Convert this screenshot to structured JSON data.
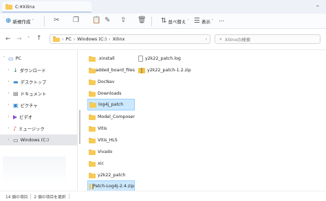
{
  "window": {
    "title": "C:¥Xilinx",
    "minimize_glyph": "–"
  },
  "toolbar": {
    "new_label": "新規作成",
    "sort_label": "並べ替え",
    "view_label": "表示",
    "more_label": "…",
    "icons": [
      "cut-icon",
      "copy-icon",
      "paste-icon",
      "rename-icon",
      "share-icon",
      "delete-icon"
    ]
  },
  "address": {
    "path": [
      "PC",
      "Windows (C:)",
      "Xilinx"
    ],
    "search_placeholder": "Xilinxの検索"
  },
  "sidebar": {
    "items": [
      {
        "label": "PC",
        "icon": "pc-icon",
        "expanded": true
      },
      {
        "label": "ダウンロード",
        "icon": "download-icon"
      },
      {
        "label": "デスクトップ",
        "icon": "desktop-icon"
      },
      {
        "label": "ドキュメント",
        "icon": "documents-icon"
      },
      {
        "label": "ピクチャ",
        "icon": "pictures-icon"
      },
      {
        "label": "ビデオ",
        "icon": "videos-icon"
      },
      {
        "label": "ミュージック",
        "icon": "music-icon"
      },
      {
        "label": "Windows (C:)",
        "icon": "drive-icon",
        "selected": true
      }
    ]
  },
  "files": {
    "column1": [
      {
        "name": ".xinstall",
        "type": "folder"
      },
      {
        "name": "added_board_files",
        "type": "folder"
      },
      {
        "name": "DocNav",
        "type": "folder"
      },
      {
        "name": "Downloads",
        "type": "folder"
      },
      {
        "name": "log4j_patch",
        "type": "folder",
        "selected": true
      },
      {
        "name": "Model_Composer",
        "type": "folder"
      },
      {
        "name": "Vitis",
        "type": "folder"
      },
      {
        "name": "Vitis_HLS",
        "type": "folder"
      },
      {
        "name": "Vivado",
        "type": "folder"
      },
      {
        "name": "xic",
        "type": "folder"
      },
      {
        "name": "y2k22_patch",
        "type": "folder"
      },
      {
        "name": "Patch-Log4j-2.4.zip",
        "type": "zip",
        "selected": true
      }
    ],
    "column2": [
      {
        "name": "y2k22_patch.log",
        "type": "file"
      },
      {
        "name": "y2k22_patch-1.2.zip",
        "type": "zip"
      }
    ]
  },
  "status": {
    "item_count": "14 個の項目",
    "selection": "2 個の項目を選択"
  },
  "colors": {
    "selection": "#cce8ff",
    "folder": "#f7c955",
    "accent": "#0067c0"
  }
}
